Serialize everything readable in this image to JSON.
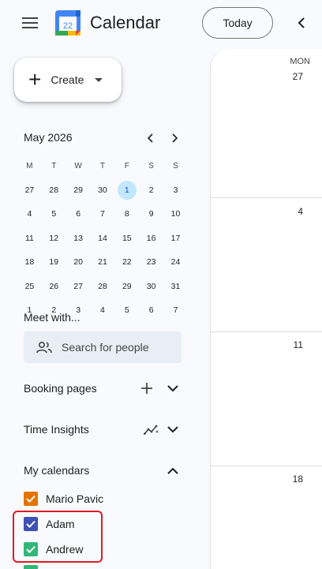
{
  "header": {
    "app_title": "Calendar",
    "logo_day": "22",
    "today_label": "Today"
  },
  "create": {
    "label": "Create"
  },
  "mini_calendar": {
    "month_label": "May 2026",
    "weekdays": [
      "M",
      "T",
      "W",
      "T",
      "F",
      "S",
      "S"
    ],
    "weeks": [
      [
        "27",
        "28",
        "29",
        "30",
        "1",
        "2",
        "3"
      ],
      [
        "4",
        "5",
        "6",
        "7",
        "8",
        "9",
        "10"
      ],
      [
        "11",
        "12",
        "13",
        "14",
        "15",
        "16",
        "17"
      ],
      [
        "18",
        "19",
        "20",
        "21",
        "22",
        "23",
        "24"
      ],
      [
        "25",
        "26",
        "27",
        "28",
        "29",
        "30",
        "31"
      ],
      [
        "1",
        "2",
        "3",
        "4",
        "5",
        "6",
        "7"
      ]
    ],
    "today": "1"
  },
  "meet_with": {
    "title": "Meet with...",
    "search_placeholder": "Search for people"
  },
  "booking_pages": {
    "title": "Booking pages"
  },
  "time_insights": {
    "title": "Time Insights"
  },
  "my_calendars": {
    "title": "My calendars",
    "items": [
      {
        "label": "Mario Pavic",
        "color": "#e37400",
        "checked": true
      },
      {
        "label": "Adam",
        "color": "#3f51b5",
        "checked": true
      },
      {
        "label": "Andrew",
        "color": "#33b679",
        "checked": true
      }
    ]
  },
  "main": {
    "day_header": "MON",
    "week_dates": [
      "27",
      "4",
      "11",
      "18"
    ]
  },
  "colors": {
    "accent": "#0b57d0",
    "today_bg": "#c2e7ff",
    "highlight": "#e01b24"
  }
}
